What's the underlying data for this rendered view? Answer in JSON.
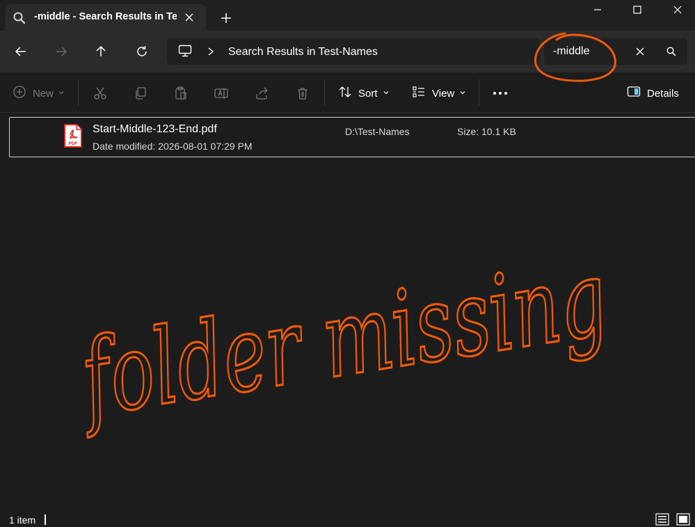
{
  "tab": {
    "title": "-middle - Search Results in Test-Names",
    "icon": "search-icon",
    "close_icon": "close-icon",
    "new_tab_icon": "plus-icon"
  },
  "window": {
    "minimize_icon": "minimize-icon",
    "maximize_icon": "maximize-icon",
    "close_icon": "close-icon"
  },
  "nav": {
    "back_icon": "arrow-left-icon",
    "forward_icon": "arrow-right-icon",
    "up_icon": "arrow-up-icon",
    "refresh_icon": "refresh-icon"
  },
  "address": {
    "breadcrumb": "Search Results in Test-Names",
    "pc_icon": "computer-icon"
  },
  "search": {
    "value": "-middle"
  },
  "toolbar": {
    "new_label": "New",
    "sort_label": "Sort",
    "view_label": "View",
    "details_label": "Details"
  },
  "files": [
    {
      "name": "Start-Middle-123-End.pdf",
      "date_modified": "Date modified: 2026-08-01 07:29 PM",
      "location": "D:\\Test-Names",
      "size": "Size: 10.1 KB",
      "icon": "pdf-file-icon",
      "icon_text": "PDF"
    }
  ],
  "status": {
    "count": "1 item"
  },
  "annotation": {
    "text": "folder missing",
    "color": "#f25a0a"
  },
  "colors": {
    "background": "#1c1c1c",
    "chrome": "#2b2b2b",
    "accent_blue": "#60cdff",
    "pdf_red": "#e02020"
  }
}
